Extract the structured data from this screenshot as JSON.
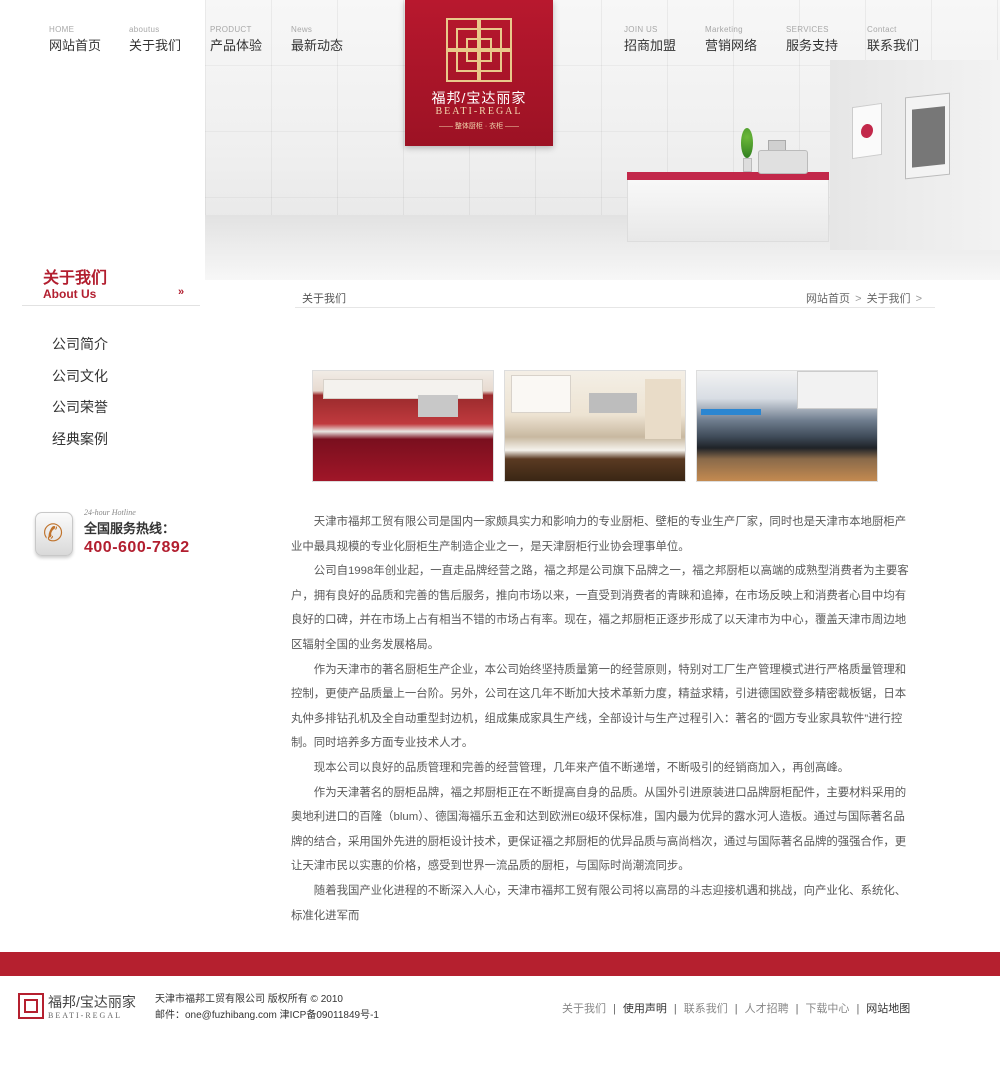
{
  "nav": {
    "left": [
      {
        "en": "HOME",
        "cn": "网站首页"
      },
      {
        "en": "aboutus",
        "cn": "关于我们"
      },
      {
        "en": "PRODUCT",
        "cn": "产品体验"
      },
      {
        "en": "News",
        "cn": "最新动态"
      }
    ],
    "right": [
      {
        "en": "JOIN US",
        "cn": "招商加盟"
      },
      {
        "en": "Marketing",
        "cn": "营销网络"
      },
      {
        "en": "SERVICES",
        "cn": "服务支持"
      },
      {
        "en": "Contact",
        "cn": "联系我们"
      }
    ]
  },
  "logo": {
    "cn": "福邦/宝达丽家",
    "en": "BEATI-REGAL",
    "tagline": "—— 整体厨柜 · 衣柜 ——"
  },
  "sidebar": {
    "title_cn": "关于我们",
    "title_en": "About Us",
    "arrow": "»",
    "items": [
      "公司简介",
      "公司文化",
      "公司荣誉",
      "经典案例"
    ],
    "hotline": {
      "sub": "24-hour Hotline",
      "label": "全国服务热线：",
      "number": "400-600-7892"
    }
  },
  "main": {
    "page_title": "关于我们",
    "breadcrumb": [
      "网站首页",
      "关于我们"
    ],
    "breadcrumb_sep": ">",
    "paragraphs": [
      "天津市福邦工贸有限公司是国内一家颇具实力和影响力的专业厨柜、壁柜的专业生产厂家，同时也是天津市本地厨柜产业中最具规模的专业化厨柜生产制造企业之一，是天津厨柜行业协会理事单位。",
      "公司自1998年创业起，一直走品牌经营之路，福之邦是公司旗下品牌之一，福之邦厨柜以高端的成熟型消费者为主要客户，拥有良好的品质和完善的售后服务，推向市场以来，一直受到消费者的青睐和追捧，在市场反映上和消费者心目中均有良好的口碑，并在市场上占有相当不错的市场占有率。现在，福之邦厨柜正逐步形成了以天津市为中心，覆盖天津市周边地区辐射全国的业务发展格局。",
      "作为天津市的著名厨柜生产企业，本公司始终坚持质量第一的经营原则，特别对工厂生产管理模式进行严格质量管理和控制，更使产品质量上一台阶。另外，公司在这几年不断加大技术革新力度，精益求精，引进德国欧登多精密裁板锯，日本丸仲多排钻孔机及全自动重型封边机，组成集成家具生产线，全部设计与生产过程引入：著名的“圆方专业家具软件”进行控制。同时培养多方面专业技术人才。",
      "现本公司以良好的品质管理和完善的经营管理，几年来产值不断递增，不断吸引的经销商加入，再创高峰。",
      "作为天津著名的厨柜品牌，福之邦厨柜正在不断提高自身的品质。从国外引进原装进口品牌厨柜配件，主要材料采用的奥地利进口的百隆（blum）、德国海福乐五金和达到欧洲E0级环保标准，国内最为优异的露水河人造板。通过与国际著名品牌的结合，采用国外先进的厨柜设计技术，更保证福之邦厨柜的优异品质与高尚档次，通过与国际著名品牌的强强合作，更让天津市民以实惠的价格，感受到世界一流品质的厨柜，与国际时尚潮流同步。",
      "随着我国产业化进程的不断深入人心，天津市福邦工贸有限公司将以高昂的斗志迎接机遇和挑战，向产业化、系统化、标准化进军而"
    ]
  },
  "footer": {
    "logo_cn": "福邦/宝达丽家",
    "logo_en": "BEATI-REGAL",
    "copyright": "天津市福邦工贸有限公司 版权所有 © 2010",
    "contact": "邮件：one@fuzhibang.com  津ICP备09011849号-1",
    "links": [
      "关于我们",
      "使用声明",
      "联系我们",
      "人才招聘",
      "下载中心",
      "网站地图"
    ],
    "link_sep": "|"
  },
  "colors": {
    "brand_red": "#b21e2f",
    "gold": "#e9c98a",
    "text": "#5a5a5a"
  }
}
